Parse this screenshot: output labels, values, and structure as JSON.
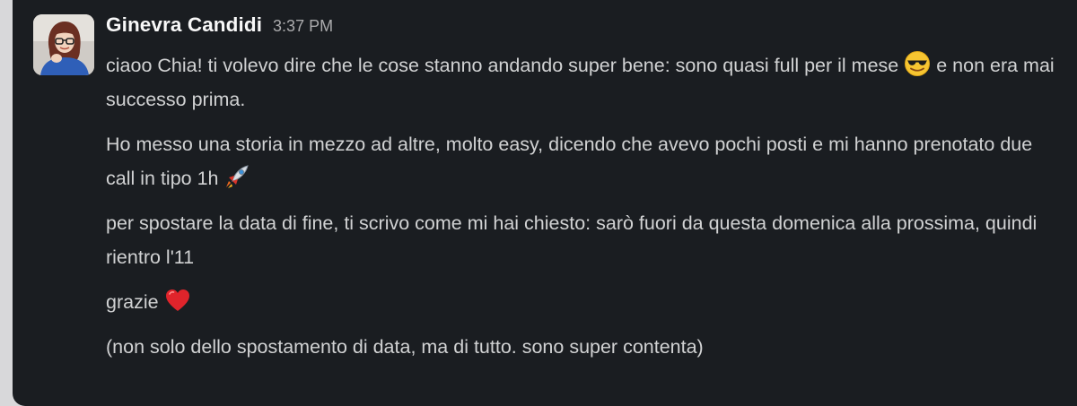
{
  "message": {
    "sender_name": "Ginevra Candidi",
    "timestamp": "3:37 PM",
    "avatar_icon": "user-avatar-photo",
    "paragraphs": [
      {
        "text_a": "ciaoo Chia! ti volevo dire che le cose stanno andando super bene: sono quasi full per il mese",
        "emoji": "sunglasses-emoji",
        "text_b": "e non era mai successo prima."
      },
      {
        "text_a": "Ho messo una storia in mezzo ad altre, molto easy, dicendo che avevo pochi posti e mi hanno prenotato due call in tipo 1h",
        "emoji": "rocket-emoji"
      },
      {
        "text_a": "per spostare la data di fine, ti scrivo come mi hai chiesto: sarò fuori da questa domenica alla prossima, quindi rientro l'11"
      },
      {
        "text_a": "grazie",
        "emoji": "red-heart-emoji"
      },
      {
        "text_a": "(non solo dello spostamento di data, ma di tutto. sono super contenta)"
      }
    ]
  },
  "colors": {
    "background": "#1a1d21",
    "sender": "#f8f8f8",
    "timestamp": "#ababad",
    "text": "#d1d2d3"
  }
}
